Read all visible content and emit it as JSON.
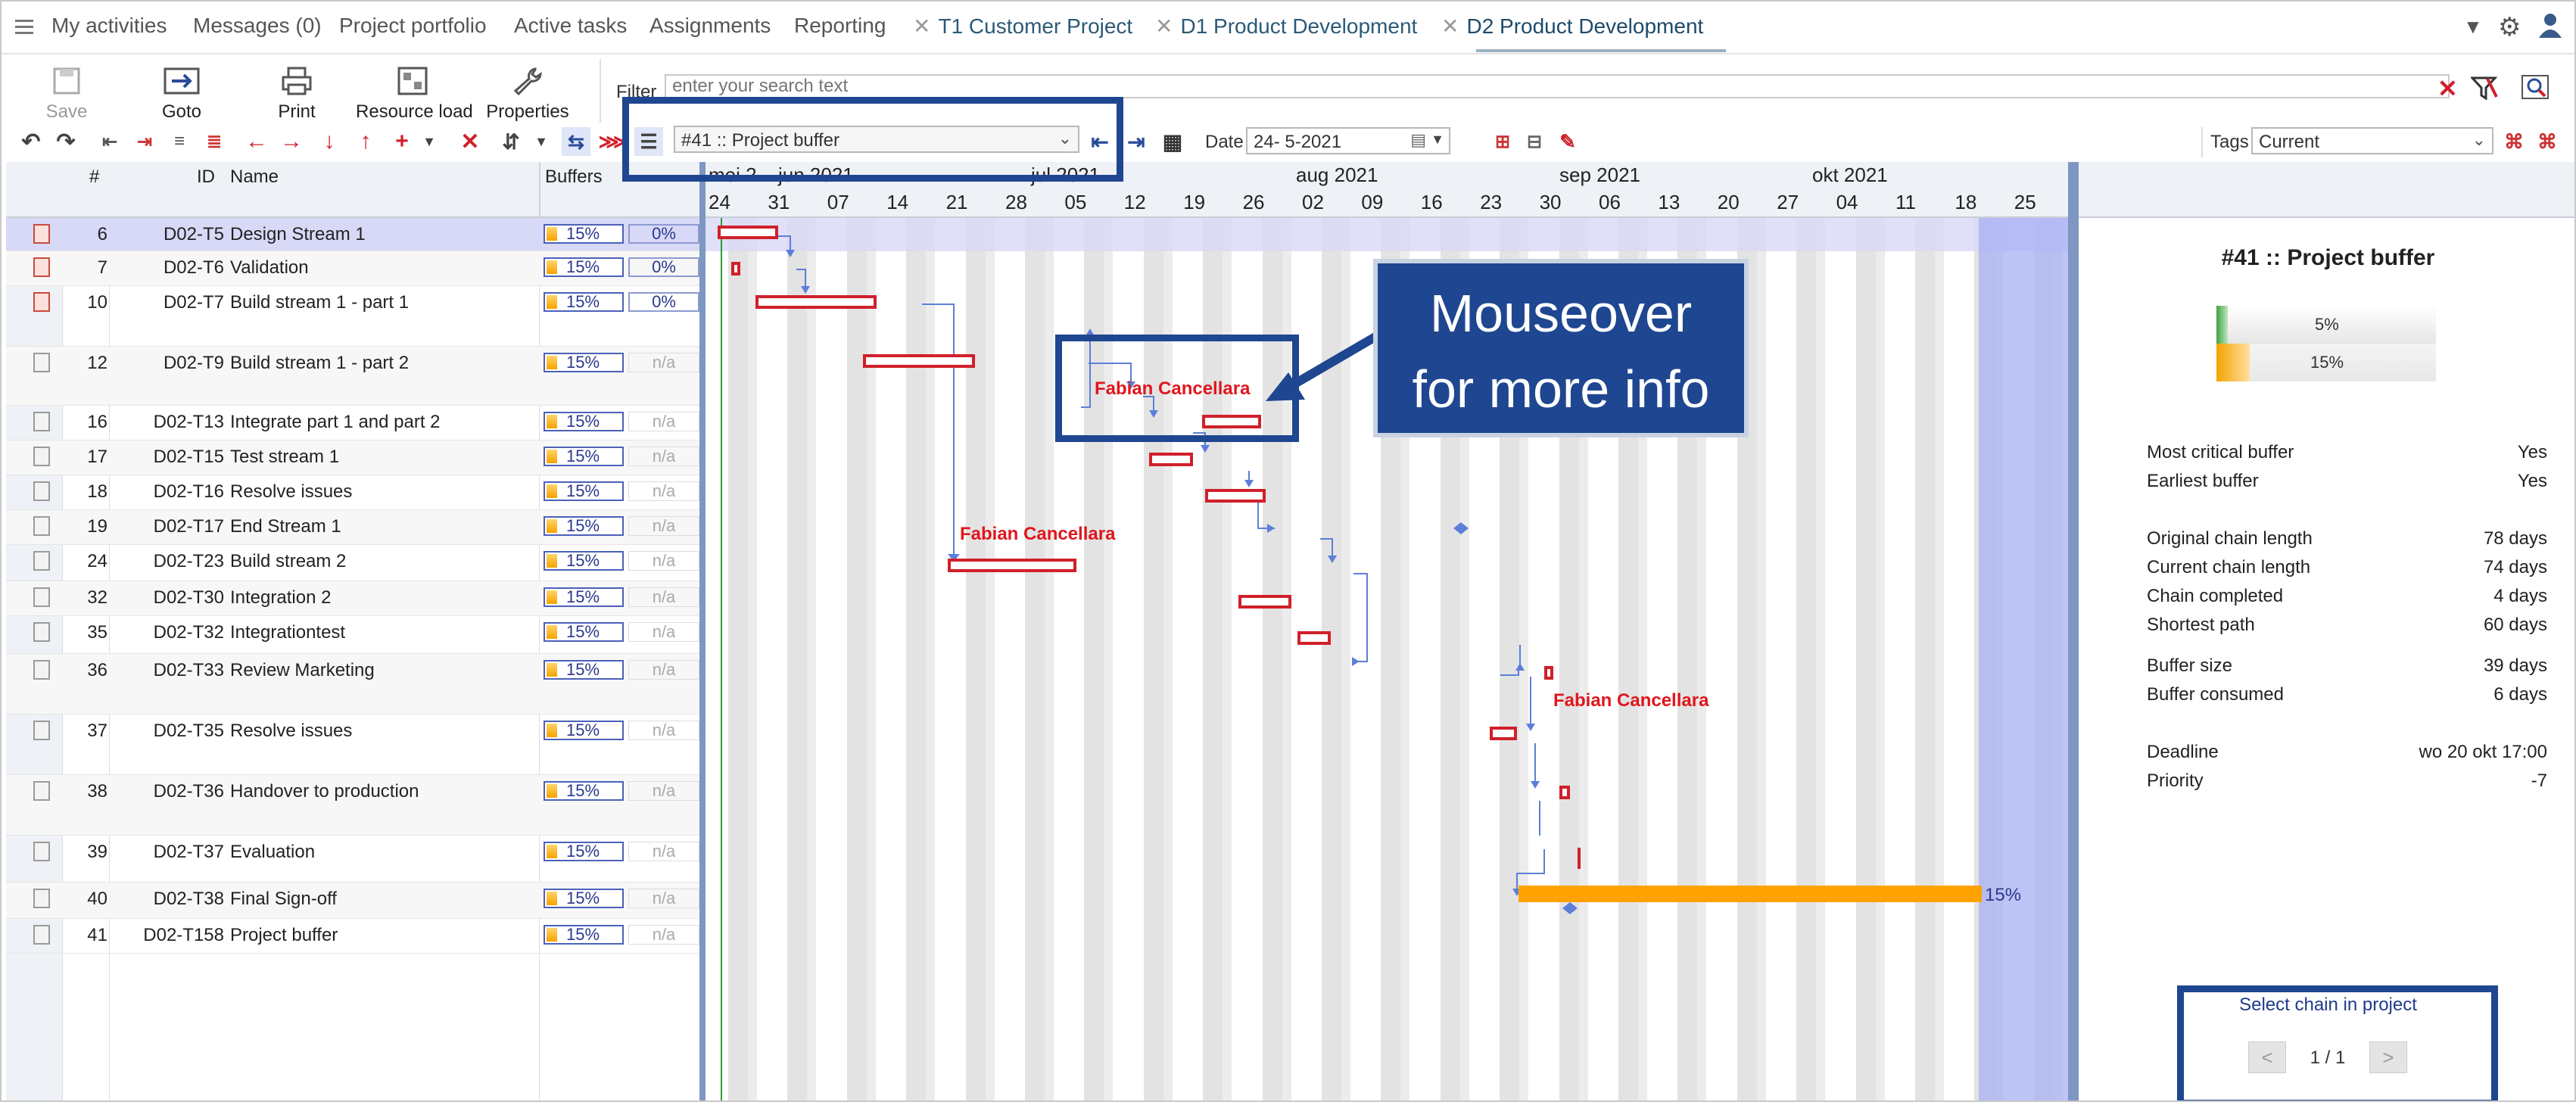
{
  "nav": {
    "items": [
      "My activities",
      "Messages (0)",
      "Project portfolio",
      "Active tasks",
      "Assignments",
      "Reporting"
    ],
    "tabs": [
      {
        "label": "T1 Customer Project",
        "active": false
      },
      {
        "label": "D1 Product Development",
        "active": false
      },
      {
        "label": "D2  Product Development",
        "active": true
      }
    ]
  },
  "toolbar": {
    "save": "Save",
    "goto": "Goto",
    "print": "Print",
    "resource_load": "Resource load",
    "properties": "Properties",
    "filter_label": "Filter",
    "filter_placeholder": "enter your search text",
    "chain_select": "#41 :: Project buffer",
    "date_label": "Date",
    "date_value": "24-  5-2021",
    "tags_label": "Tags",
    "tags_value": "Current"
  },
  "grid": {
    "headers": {
      "num": "#",
      "id": "ID",
      "name": "Name",
      "buffers": "Buffers"
    },
    "rows": [
      {
        "num": "6",
        "id": "D02-T5",
        "name": "Design Stream 1",
        "buffer": "15%",
        "pct": "0%"
      },
      {
        "num": "7",
        "id": "D02-T6",
        "name": "Validation",
        "buffer": "15%",
        "pct": "0%"
      },
      {
        "num": "10",
        "id": "D02-T7",
        "name": "Build stream 1 - part 1",
        "buffer": "15%",
        "pct": "0%"
      },
      {
        "num": "12",
        "id": "D02-T9",
        "name": "Build stream 1 - part 2",
        "buffer": "15%",
        "pct": "n/a"
      },
      {
        "num": "16",
        "id": "D02-T13",
        "name": "Integrate part 1 and part 2",
        "buffer": "15%",
        "pct": "n/a"
      },
      {
        "num": "17",
        "id": "D02-T15",
        "name": "Test stream 1",
        "buffer": "15%",
        "pct": "n/a"
      },
      {
        "num": "18",
        "id": "D02-T16",
        "name": "Resolve issues",
        "buffer": "15%",
        "pct": "n/a"
      },
      {
        "num": "19",
        "id": "D02-T17",
        "name": "End Stream 1",
        "buffer": "15%",
        "pct": "n/a"
      },
      {
        "num": "24",
        "id": "D02-T23",
        "name": "Build stream 2",
        "buffer": "15%",
        "pct": "n/a"
      },
      {
        "num": "32",
        "id": "D02-T30",
        "name": "Integration 2",
        "buffer": "15%",
        "pct": "n/a"
      },
      {
        "num": "35",
        "id": "D02-T32",
        "name": "Integrationtest",
        "buffer": "15%",
        "pct": "n/a"
      },
      {
        "num": "36",
        "id": "D02-T33",
        "name": "Review Marketing",
        "buffer": "15%",
        "pct": "n/a"
      },
      {
        "num": "37",
        "id": "D02-T35",
        "name": "Resolve issues",
        "buffer": "15%",
        "pct": "n/a"
      },
      {
        "num": "38",
        "id": "D02-T36",
        "name": "Handover to production",
        "buffer": "15%",
        "pct": "n/a"
      },
      {
        "num": "39",
        "id": "D02-T37",
        "name": "Evaluation",
        "buffer": "15%",
        "pct": "n/a"
      },
      {
        "num": "40",
        "id": "D02-T38",
        "name": "Final Sign-off",
        "buffer": "15%",
        "pct": "n/a"
      },
      {
        "num": "41",
        "id": "D02-T158",
        "name": "Project buffer",
        "buffer": "15%",
        "pct": "n/a"
      }
    ]
  },
  "gantt": {
    "months": [
      "mei 2",
      "jun 2021",
      "jul 2021",
      "aug 2021",
      "sep 2021",
      "okt 2021"
    ],
    "days": [
      "24",
      "31",
      "07",
      "14",
      "21",
      "28",
      "05",
      "12",
      "19",
      "26",
      "02",
      "09",
      "16",
      "23",
      "30",
      "06",
      "13",
      "20",
      "27",
      "04",
      "11",
      "18",
      "25"
    ],
    "resource_name": "Fabian Cancellara",
    "buffer_pct": "15%"
  },
  "panel": {
    "title": "#41 :: Project buffer",
    "gauge_small": "5%",
    "gauge_big": "15%",
    "gauge_consumed_fraction": 0.05,
    "gauge_size_fraction": 0.15,
    "stats1": [
      {
        "k": "Most critical buffer",
        "v": "Yes"
      },
      {
        "k": "Earliest buffer",
        "v": "Yes"
      }
    ],
    "stats2": [
      {
        "k": "Original chain length",
        "v": "78 days"
      },
      {
        "k": "Current chain length",
        "v": "74 days"
      },
      {
        "k": "Chain completed",
        "v": "4 days"
      },
      {
        "k": "Shortest path",
        "v": "60 days"
      }
    ],
    "stats3": [
      {
        "k": "Buffer size",
        "v": "39 days"
      },
      {
        "k": "Buffer consumed",
        "v": "6 days"
      }
    ],
    "stats4": [
      {
        "k": "Deadline",
        "v": "wo 20 okt 17:00"
      },
      {
        "k": "Priority",
        "v": "-7"
      }
    ],
    "select_chain": "Select chain in project",
    "pager_prev": "<",
    "pager_text": "1 / 1",
    "pager_next": ">"
  },
  "callout": {
    "line1": "Mouseover",
    "line2": "for more info"
  },
  "colors": {
    "accent": "#1f4690",
    "bar_red": "#d0202a",
    "buffer_orange": "#ffa200",
    "buffer_zone": "#a8b0f2"
  }
}
